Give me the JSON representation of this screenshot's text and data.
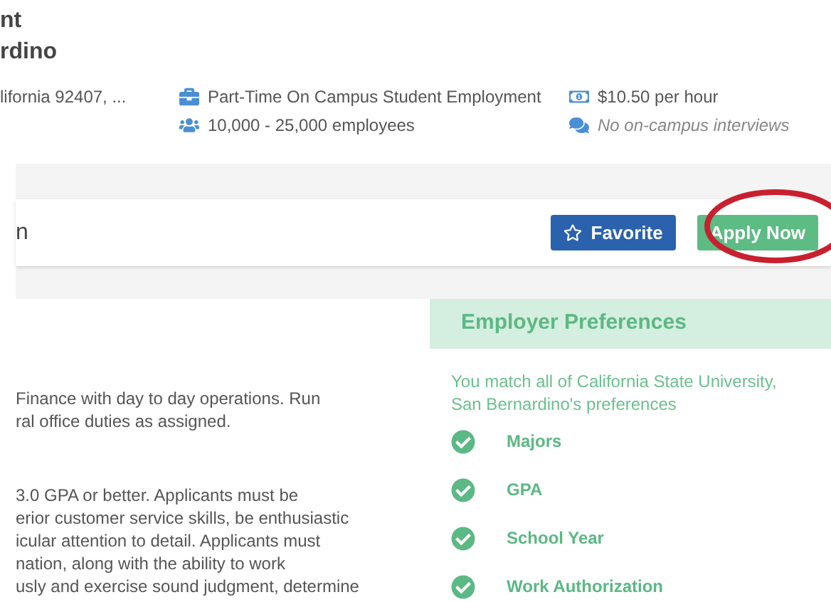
{
  "header": {
    "title_lines": [
      "nt",
      "rdino"
    ],
    "location": "lifornia 92407, ...",
    "details": [
      {
        "kind": "job_type",
        "text": "Part-Time On Campus Student Employment"
      },
      {
        "kind": "pay",
        "text": "$10.50 per hour"
      },
      {
        "kind": "company_size",
        "text": "10,000 - 25,000 employees"
      },
      {
        "kind": "interviews",
        "text": "No on-campus interviews"
      }
    ]
  },
  "action_bar": {
    "title": "n",
    "favorite": {
      "label": "Favorite",
      "favorited": false
    },
    "apply": {
      "label": "Apply Now",
      "highlighted": true
    }
  },
  "description": {
    "paragraphs": [
      [
        "Finance with day to day operations. Run",
        "ral office duties as assigned."
      ],
      [
        "3.0 GPA or better. Applicants must be",
        "erior customer service skills, be enthusiastic",
        "icular attention to detail. Applicants must",
        "nation, along with the ability to work",
        "usly and exercise sound judgment, determine"
      ]
    ]
  },
  "employer_preferences": {
    "title": "Employer Preferences",
    "summary": "You match all of California State University, San Bernardino's preferences",
    "items": [
      {
        "label": "Majors",
        "matched": true
      },
      {
        "label": "GPA",
        "matched": true
      },
      {
        "label": "School Year",
        "matched": true
      },
      {
        "label": "Work Authorization",
        "matched": true
      }
    ]
  }
}
